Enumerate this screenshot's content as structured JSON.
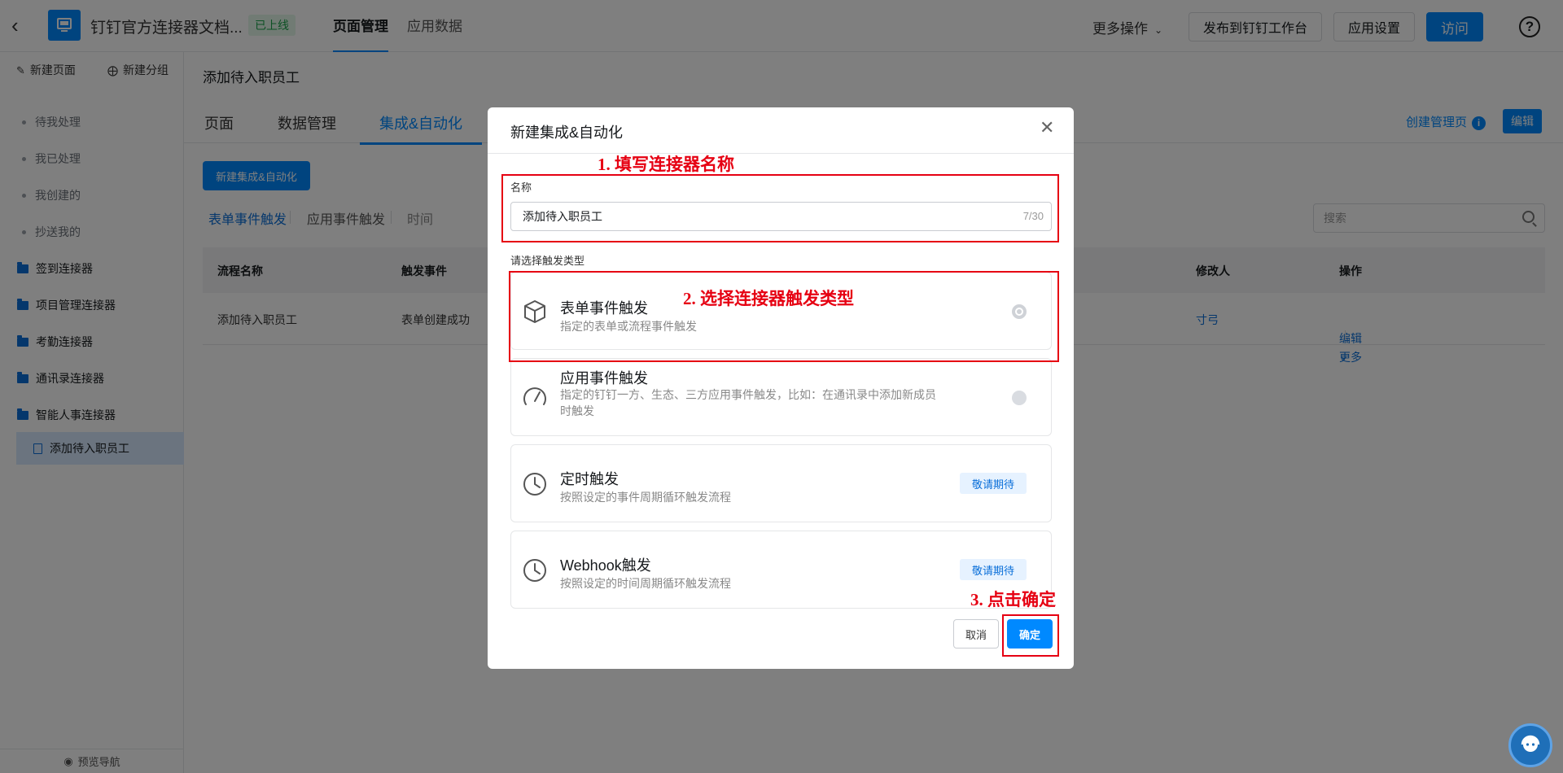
{
  "header": {
    "app_name": "钉钉官方连接器文档...",
    "status_badge": "已上线",
    "nav_tabs": [
      "页面管理",
      "应用数据"
    ],
    "more_ops": "更多操作",
    "publish_button": "发布到钉钉工作台",
    "settings_button": "应用设置",
    "visit_button": "访问",
    "help": "?"
  },
  "sidebar": {
    "new_page": "新建页面",
    "new_group": "新建分组",
    "items": [
      {
        "label": "待我处理"
      },
      {
        "label": "我已处理"
      },
      {
        "label": "我创建的"
      },
      {
        "label": "抄送我的"
      },
      {
        "label": "签到连接器"
      },
      {
        "label": "项目管理连接器"
      },
      {
        "label": "考勤连接器"
      },
      {
        "label": "通讯录连接器"
      },
      {
        "label": "智能人事连接器"
      },
      {
        "label": "添加待入职员工"
      }
    ],
    "preview_nav": "预览导航"
  },
  "main": {
    "page_title": "添加待入职员工",
    "tabs": [
      "页面",
      "数据管理",
      "集成&自动化"
    ],
    "create_mgmt_page": "创建管理页",
    "edit_button": "编辑",
    "new_integration_button": "新建集成&自动化",
    "subtabs": [
      "表单事件触发",
      "应用事件触发",
      "时间"
    ],
    "search_placeholder": "搜索",
    "table": {
      "headers": [
        "流程名称",
        "触发事件",
        "修改人",
        "操作"
      ],
      "rows": [
        {
          "name": "添加待入职员工",
          "event": "表单创建成功",
          "modifier": "寸弓",
          "edit": "编辑",
          "more": "更多"
        }
      ]
    }
  },
  "modal": {
    "title": "新建集成&自动化",
    "name_label": "名称",
    "name_value": "添加待入职员工",
    "name_count": "7/30",
    "trigger_label": "请选择触发类型",
    "options": [
      {
        "title": "表单事件触发",
        "desc": "指定的表单或流程事件触发"
      },
      {
        "title": "应用事件触发",
        "desc": "指定的钉钉一方、生态、三方应用事件触发，比如：在通讯录中添加新成员时触发"
      },
      {
        "title": "定时触发",
        "desc": "按照设定的事件周期循环触发流程",
        "badge": "敬请期待"
      },
      {
        "title": "Webhook触发",
        "desc": "按照设定的时间周期循环触发流程",
        "badge": "敬请期待"
      }
    ],
    "cancel_button": "取消",
    "confirm_button": "确定"
  },
  "annotations": {
    "step1": "1. 填写连接器名称",
    "step2": "2. 选择连接器触发类型",
    "step3": "3. 点击确定"
  },
  "colors": {
    "accent": "#0089ff",
    "annotation": "#e60012",
    "live_badge": "#1aa34a"
  }
}
